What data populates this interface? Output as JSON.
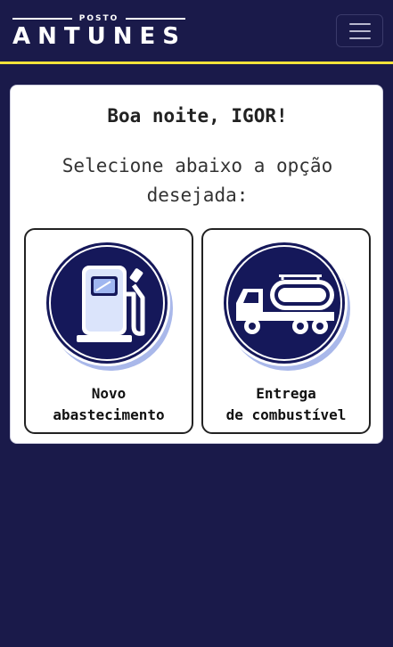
{
  "brand": {
    "top": "POSTO",
    "main": "ANTUNES"
  },
  "greeting": "Boa noite, IGOR!",
  "prompt": "Selecione abaixo a opção desejada:",
  "options": [
    {
      "line1": "Novo",
      "line2": "abastecimento",
      "icon": "fuel-pump-icon"
    },
    {
      "line1": "Entrega",
      "line2": "de combustível",
      "icon": "tanker-truck-icon"
    }
  ],
  "colors": {
    "background": "#1a1a4a",
    "accent": "#f2e23a",
    "icon_navy": "#15185a"
  }
}
